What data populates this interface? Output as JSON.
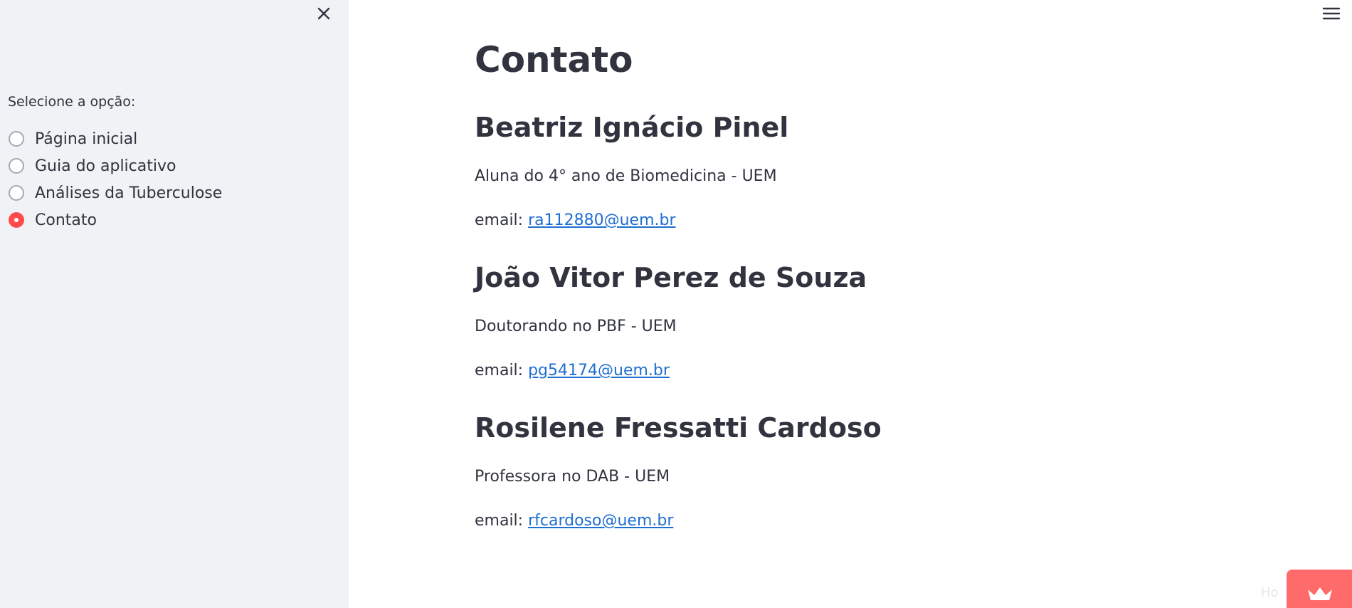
{
  "sidebar": {
    "radio_title": "Selecione a opção:",
    "options": [
      {
        "label": "Página inicial",
        "checked": false
      },
      {
        "label": "Guia do aplicativo",
        "checked": false
      },
      {
        "label": "Análises da Tuberculose",
        "checked": false
      },
      {
        "label": "Contato",
        "checked": true
      }
    ],
    "icons": {
      "close": "close-icon"
    }
  },
  "header": {
    "icons": {
      "menu": "hamburger-menu-icon"
    }
  },
  "main": {
    "title": "Contato",
    "contacts": [
      {
        "name": "Beatriz Ignácio Pinel",
        "role": "Aluna do 4° ano de Biomedicina - UEM",
        "email_label": "email:",
        "email": "ra112880@uem.br"
      },
      {
        "name": "João Vitor Perez de Souza",
        "role": "Doutorando no PBF - UEM",
        "email_label": "email:",
        "email": "pg54174@uem.br"
      },
      {
        "name": "Rosilene Fressatti Cardoso",
        "role": "Professora no DAB - UEM",
        "email_label": "email:",
        "email": "rfcardoso@uem.br"
      }
    ]
  },
  "footer": {
    "hosted_text": "Ho",
    "badge_icon": "crown-icon"
  },
  "colors": {
    "accent": "#ff4b4b",
    "link": "#1f6fd0",
    "sidebar_bg": "#f0f2f6",
    "text": "#31333f"
  }
}
